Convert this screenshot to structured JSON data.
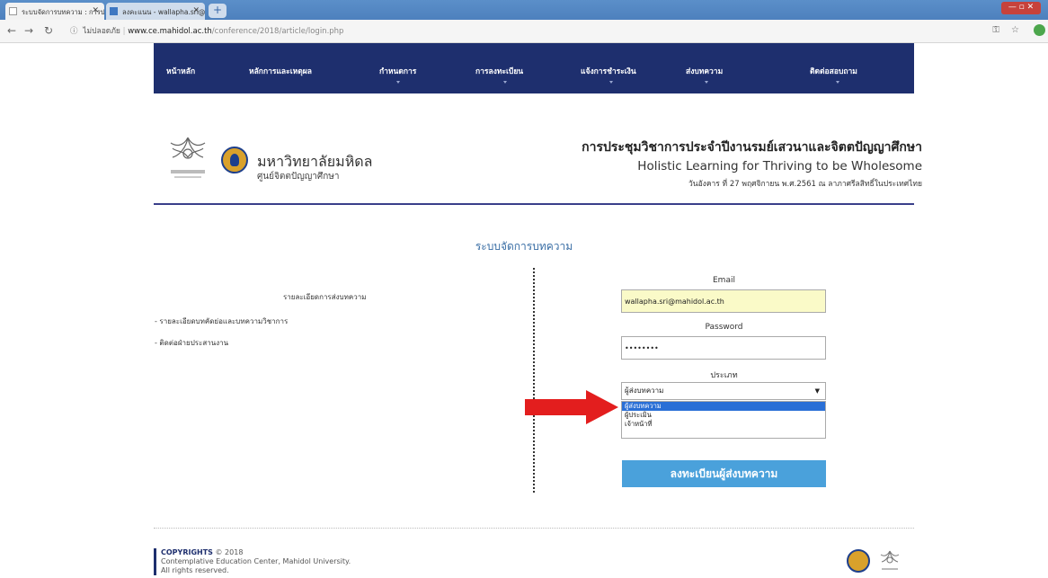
{
  "browser": {
    "tabs": [
      {
        "title": "ระบบจัดการบทความ : การประชุมวิชา"
      },
      {
        "title": "ลงคะแนน - wallapha.sri@mahidol"
      }
    ],
    "new_tab": "+",
    "url_info": "ไม่ปลอดภัย",
    "url_host": "www.ce.mahidol.ac.th",
    "url_path": "/conference/2018/article/login.php"
  },
  "nav": {
    "items": [
      "หน้าหลัก",
      "หลักการและเหตุผล",
      "กำหนดการ",
      "การลงทะเบียน",
      "แจ้งการชำระเงิน",
      "ส่งบทความ",
      "ติดต่อสอบถาม"
    ]
  },
  "header": {
    "uni_th": "มหาวิทยาลัยมหิดล",
    "uni_sub": "ศูนย์จิตตปัญญาศึกษา",
    "conf_th": "การประชุมวิชาการประจำปีงานรมย์เสวนาและจิตตปัญญาศึกษา",
    "conf_en": "Holistic Learning for Thriving to be Wholesome",
    "conf_date": "วันอังคาร ที่ 27 พฤศจิกายน พ.ศ.2561 ณ ลาภาศรีลสิทธิ์ในประเทศไทย"
  },
  "page_title": "ระบบจัดการบทความ",
  "left": {
    "heading": "รายละเอียดการส่งบทความ",
    "links": [
      "- รายละเอียดบทคัดย่อและบทความวิชาการ",
      "- ติดต่อฝ่ายประสานงาน"
    ]
  },
  "form": {
    "email_label": "Email",
    "email_value": "wallapha.sri@mahidol.ac.th",
    "password_label": "Password",
    "password_value": "••••••••",
    "type_label": "ประเภท",
    "type_selected": "ผู้ส่งบทความ",
    "type_options": [
      "ผู้ส่งบทความ",
      "ผู้ประเมิน",
      "เจ้าหน้าที่"
    ],
    "submit_label": "ลงทะเบียนผู้ส่งบทความ"
  },
  "footer": {
    "copyright_label": "COPYRIGHTS",
    "copyright_year": "© 2018",
    "line2": "Contemplative Education Center, Mahidol University.",
    "line3": "All rights reserved."
  },
  "colors": {
    "nav_bg": "#1e2f6e",
    "submit_bg": "#4aa1db",
    "selected_option": "#2a6fd6",
    "arrow": "#e31e1e",
    "email_bg": "#fafac8"
  }
}
